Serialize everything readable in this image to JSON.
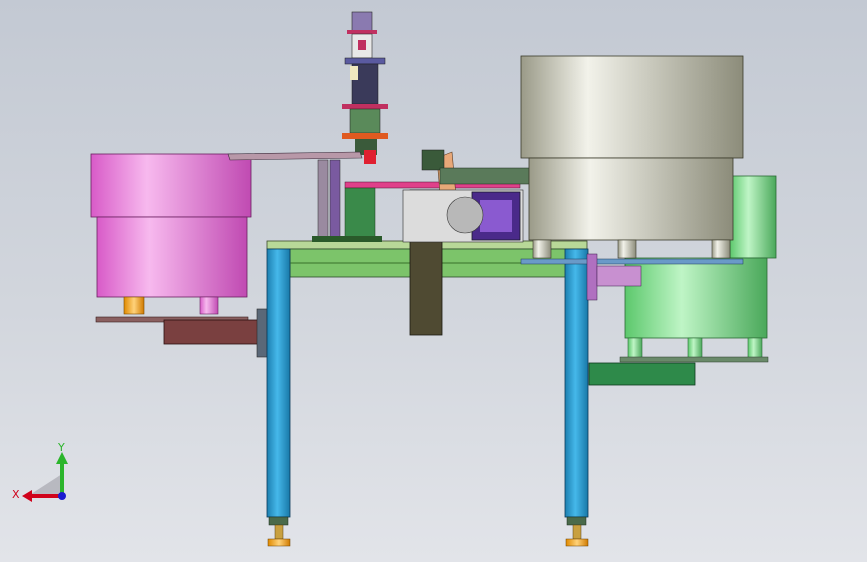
{
  "viewport": {
    "background_top": "#c3c9d3",
    "background_bottom": "#e2e4e9"
  },
  "triad": {
    "x_label": "X",
    "y_label": "Y",
    "x_color": "#d0021b",
    "y_color": "#2bb52b",
    "z_color": "#1b1bd0"
  },
  "colors": {
    "left_bowl": "#e872d8",
    "right_bowl": "#c8c8b8",
    "green_bowl": "#7fe08a",
    "legs": "#2aa0d8",
    "table_top": "#9ad07a",
    "brown_chute": "#7a4040",
    "gray_dark": "#4f4a32"
  }
}
